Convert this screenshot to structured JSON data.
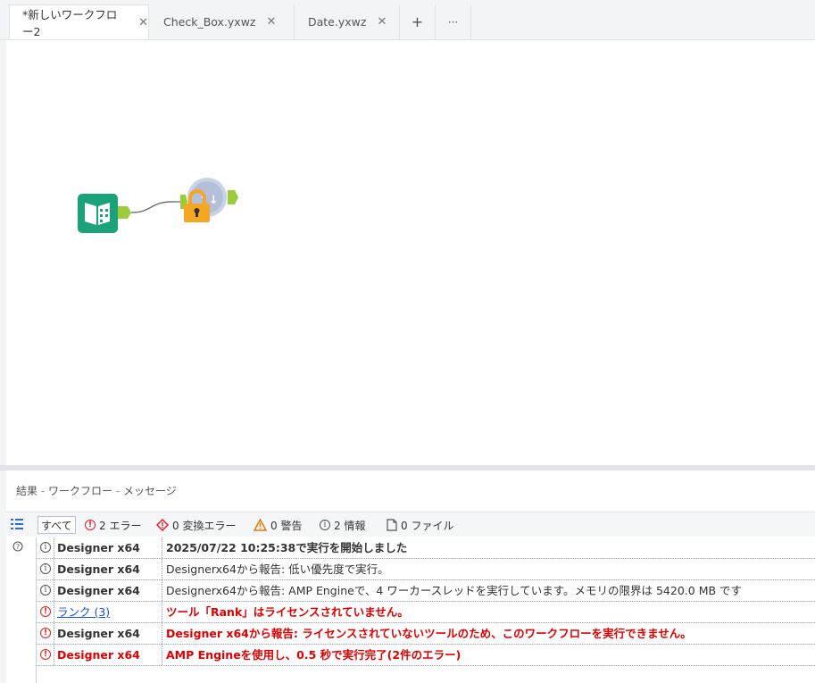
{
  "tabs": [
    {
      "label": "*新しいワークフロー2",
      "close": "✕",
      "active": true
    },
    {
      "label": "Check_Box.yxwz",
      "close": "✕",
      "active": false
    },
    {
      "label": "Date.yxwz",
      "close": "✕",
      "active": false
    }
  ],
  "tab_actions": {
    "add": "+",
    "more": "···"
  },
  "canvas": {
    "tools": [
      {
        "name": "input-data-tool",
        "icon": "book-icon",
        "color": "#1aa37a"
      },
      {
        "name": "rank-tool",
        "icon": "lock-icon",
        "locked": true,
        "color": "#f5a623"
      }
    ]
  },
  "results": {
    "title": "結果",
    "sep": "-",
    "crumb_workflow": "ワークフロー",
    "crumb_messages": "メッセージ",
    "filters": {
      "all": "すべて",
      "errors": "2 エラー",
      "conversion_errors": "0 変換エラー",
      "warnings": "0 警告",
      "info": "2 情報",
      "files": "0 ファイル"
    },
    "messages": [
      {
        "type": "info",
        "source": "Designer x64",
        "text": "2025/07/22 10:25:38で実行を開始しました"
      },
      {
        "type": "info",
        "source": "Designer x64",
        "text": "Designerx64から報告: 低い優先度で実行。"
      },
      {
        "type": "info",
        "source": "Designer x64",
        "text": "Designerx64から報告: AMP Engineで、4 ワーカースレッドを実行しています。メモリの限界は 5420.0 MB です"
      },
      {
        "type": "error",
        "source": "ランク (3)",
        "text": "ツール「Rank」はライセンスされていません。"
      },
      {
        "type": "error",
        "source": "Designer x64",
        "text": "Designer x64から報告: ライセンスされていないツールのため、このワークフローを実行できません。"
      },
      {
        "type": "error",
        "source": "Designer x64",
        "text": "AMP Engineを使用し、0.5 秒で実行完了(2件のエラー)"
      }
    ]
  },
  "colors": {
    "error": "#e00000",
    "link": "#1a4fd6",
    "tool_green": "#1aa37a",
    "lock_orange": "#f5a623",
    "connector": "#9ccc3c"
  }
}
